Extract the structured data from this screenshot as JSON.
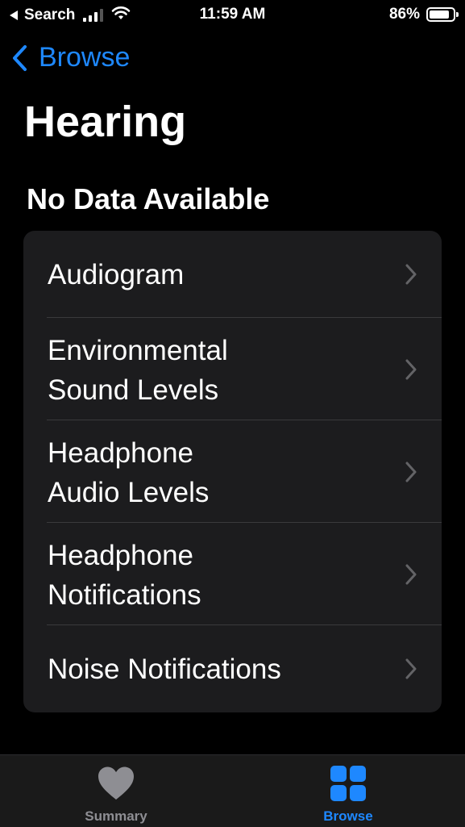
{
  "status_bar": {
    "back_label": "Search",
    "time": "11:59 AM",
    "battery_percent": "86%",
    "battery_level": 0.86
  },
  "nav": {
    "back_label": "Browse"
  },
  "page": {
    "title": "Hearing",
    "section_title": "No Data Available"
  },
  "list": {
    "items": [
      {
        "label": "Audiogram"
      },
      {
        "label": "Environmental\nSound Levels"
      },
      {
        "label": "Headphone\nAudio Levels"
      },
      {
        "label": "Headphone\nNotifications"
      },
      {
        "label": "Noise Notifications"
      }
    ]
  },
  "tab_bar": {
    "tabs": [
      {
        "label": "Summary",
        "icon": "heart-icon",
        "active": false
      },
      {
        "label": "Browse",
        "icon": "grid-icon",
        "active": true
      }
    ]
  },
  "colors": {
    "accent": "#1e88ff",
    "background": "#000000",
    "card": "#1c1c1e",
    "inactive": "#8e8e93"
  }
}
